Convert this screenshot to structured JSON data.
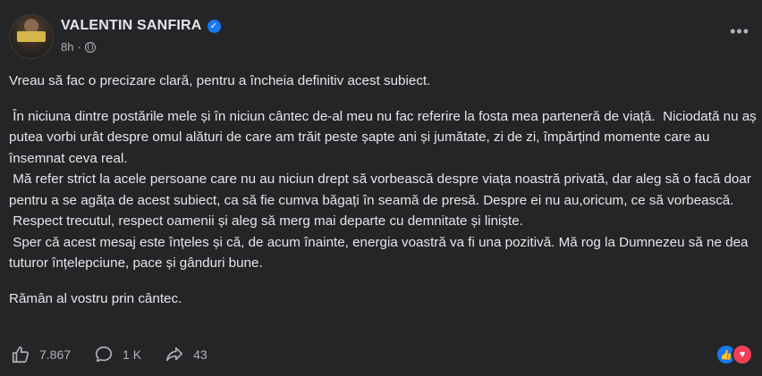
{
  "author": {
    "name": "VALENTIN SANFIRA"
  },
  "meta": {
    "time": "8h",
    "separator": "·"
  },
  "post_paragraphs": [
    "Vreau să fac o precizare clară, pentru a încheia definitiv acest subiect.",
    " În niciuna dintre postările mele și în niciun cântec de-al meu nu fac referire la fosta mea parteneră de viață.  Niciodată nu aș putea vorbi urât despre omul alături de care am trăit peste șapte ani și jumătate, zi de zi, împărțind momente care au însemnat ceva real.\n Mă refer strict la acele persoane care nu au niciun drept să vorbească despre viața noastră privată, dar aleg să o facă doar pentru a se agăța de acest subiect, ca să fie cumva băgați în seamă de presă. Despre ei nu au,oricum, ce să vorbească.\n Respect trecutul, respect oamenii și aleg să merg mai departe cu demnitate și liniște.\n Sper că acest mesaj este înțeles și că, de acum înainte, energia voastră va fi una pozitivă. Mă rog la Dumnezeu să ne dea tuturor înțelepciune, pace și gânduri bune.",
    "Rămân al vostru prin cântec."
  ],
  "footer": {
    "likes": "7.867",
    "comments": "1 K",
    "shares": "43"
  },
  "icons": {
    "verified": "verified-badge-icon",
    "globe": "globe-icon",
    "more": "more-options-icon",
    "like": "thumbs-up-icon",
    "comment": "comment-bubble-icon",
    "share": "share-arrow-icon"
  },
  "colors": {
    "background": "#242526",
    "text": "#e4e6eb",
    "secondary_text": "#b0b3b8",
    "verified": "#1877f2",
    "love": "#f33e58"
  }
}
